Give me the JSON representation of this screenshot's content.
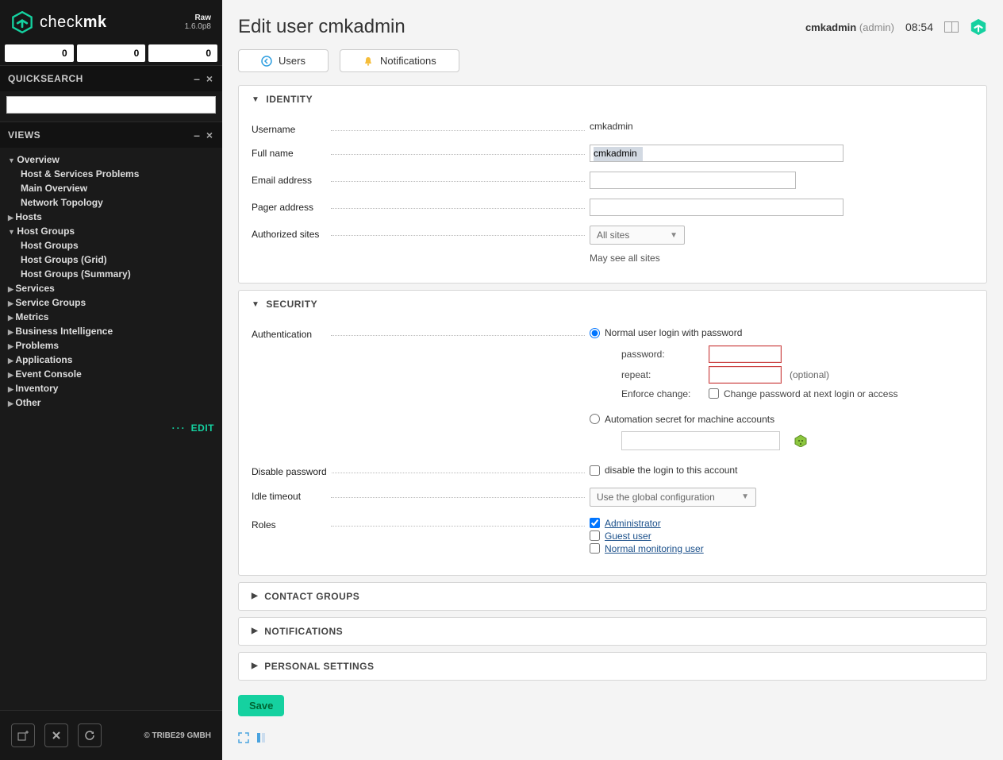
{
  "app": {
    "name_prefix": "check",
    "name_bold": "mk",
    "edition": "Raw",
    "version": "1.6.0p8",
    "copyright": "© TRIBE29 GMBH"
  },
  "tactical": {
    "values": [
      "0",
      "0",
      "0"
    ]
  },
  "quicksearch": {
    "title": "QUICKSEARCH",
    "value": ""
  },
  "views": {
    "title": "VIEWS",
    "edit_label": "EDIT",
    "tree": [
      {
        "label": "Overview",
        "open": true,
        "children": [
          {
            "label": "Host & Services Problems"
          },
          {
            "label": "Main Overview"
          },
          {
            "label": "Network Topology"
          }
        ]
      },
      {
        "label": "Hosts",
        "open": false
      },
      {
        "label": "Host Groups",
        "open": true,
        "children": [
          {
            "label": "Host Groups"
          },
          {
            "label": "Host Groups (Grid)"
          },
          {
            "label": "Host Groups (Summary)"
          }
        ]
      },
      {
        "label": "Services",
        "open": false
      },
      {
        "label": "Service Groups",
        "open": false
      },
      {
        "label": "Metrics",
        "open": false
      },
      {
        "label": "Business Intelligence",
        "open": false
      },
      {
        "label": "Problems",
        "open": false
      },
      {
        "label": "Applications",
        "open": false
      },
      {
        "label": "Event Console",
        "open": false
      },
      {
        "label": "Inventory",
        "open": false
      },
      {
        "label": "Other",
        "open": false
      }
    ]
  },
  "header": {
    "title": "Edit user cmkadmin",
    "user": "cmkadmin",
    "role": "(admin)",
    "time": "08:54"
  },
  "actions": {
    "users": "Users",
    "notifications": "Notifications"
  },
  "sections": {
    "identity": {
      "title": "IDENTITY",
      "username_label": "Username",
      "username_value": "cmkadmin",
      "fullname_label": "Full name",
      "fullname_value": "cmkadmin",
      "email_label": "Email address",
      "email_value": "",
      "pager_label": "Pager address",
      "pager_value": "",
      "authsites_label": "Authorized sites",
      "authsites_value": "All sites",
      "authsites_hint": "May see all sites"
    },
    "security": {
      "title": "SECURITY",
      "auth_label": "Authentication",
      "auth_normal": "Normal user login with password",
      "pw_label": "password:",
      "pw_value": "",
      "repeat_label": "repeat:",
      "repeat_value": "",
      "repeat_opt": "(optional)",
      "enforce_label": "Enforce change:",
      "enforce_check": "Change password at next login or access",
      "auth_automation": "Automation secret for machine accounts",
      "automation_value": "",
      "disable_label": "Disable password",
      "disable_check": "disable the login to this account",
      "idle_label": "Idle timeout",
      "idle_value": "Use the global configuration",
      "roles_label": "Roles",
      "roles": [
        "Administrator",
        "Guest user",
        "Normal monitoring user"
      ],
      "roles_checked": [
        true,
        false,
        false
      ]
    },
    "contact_groups": {
      "title": "CONTACT GROUPS"
    },
    "notifications": {
      "title": "NOTIFICATIONS"
    },
    "personal": {
      "title": "PERSONAL SETTINGS"
    }
  },
  "save_label": "Save"
}
